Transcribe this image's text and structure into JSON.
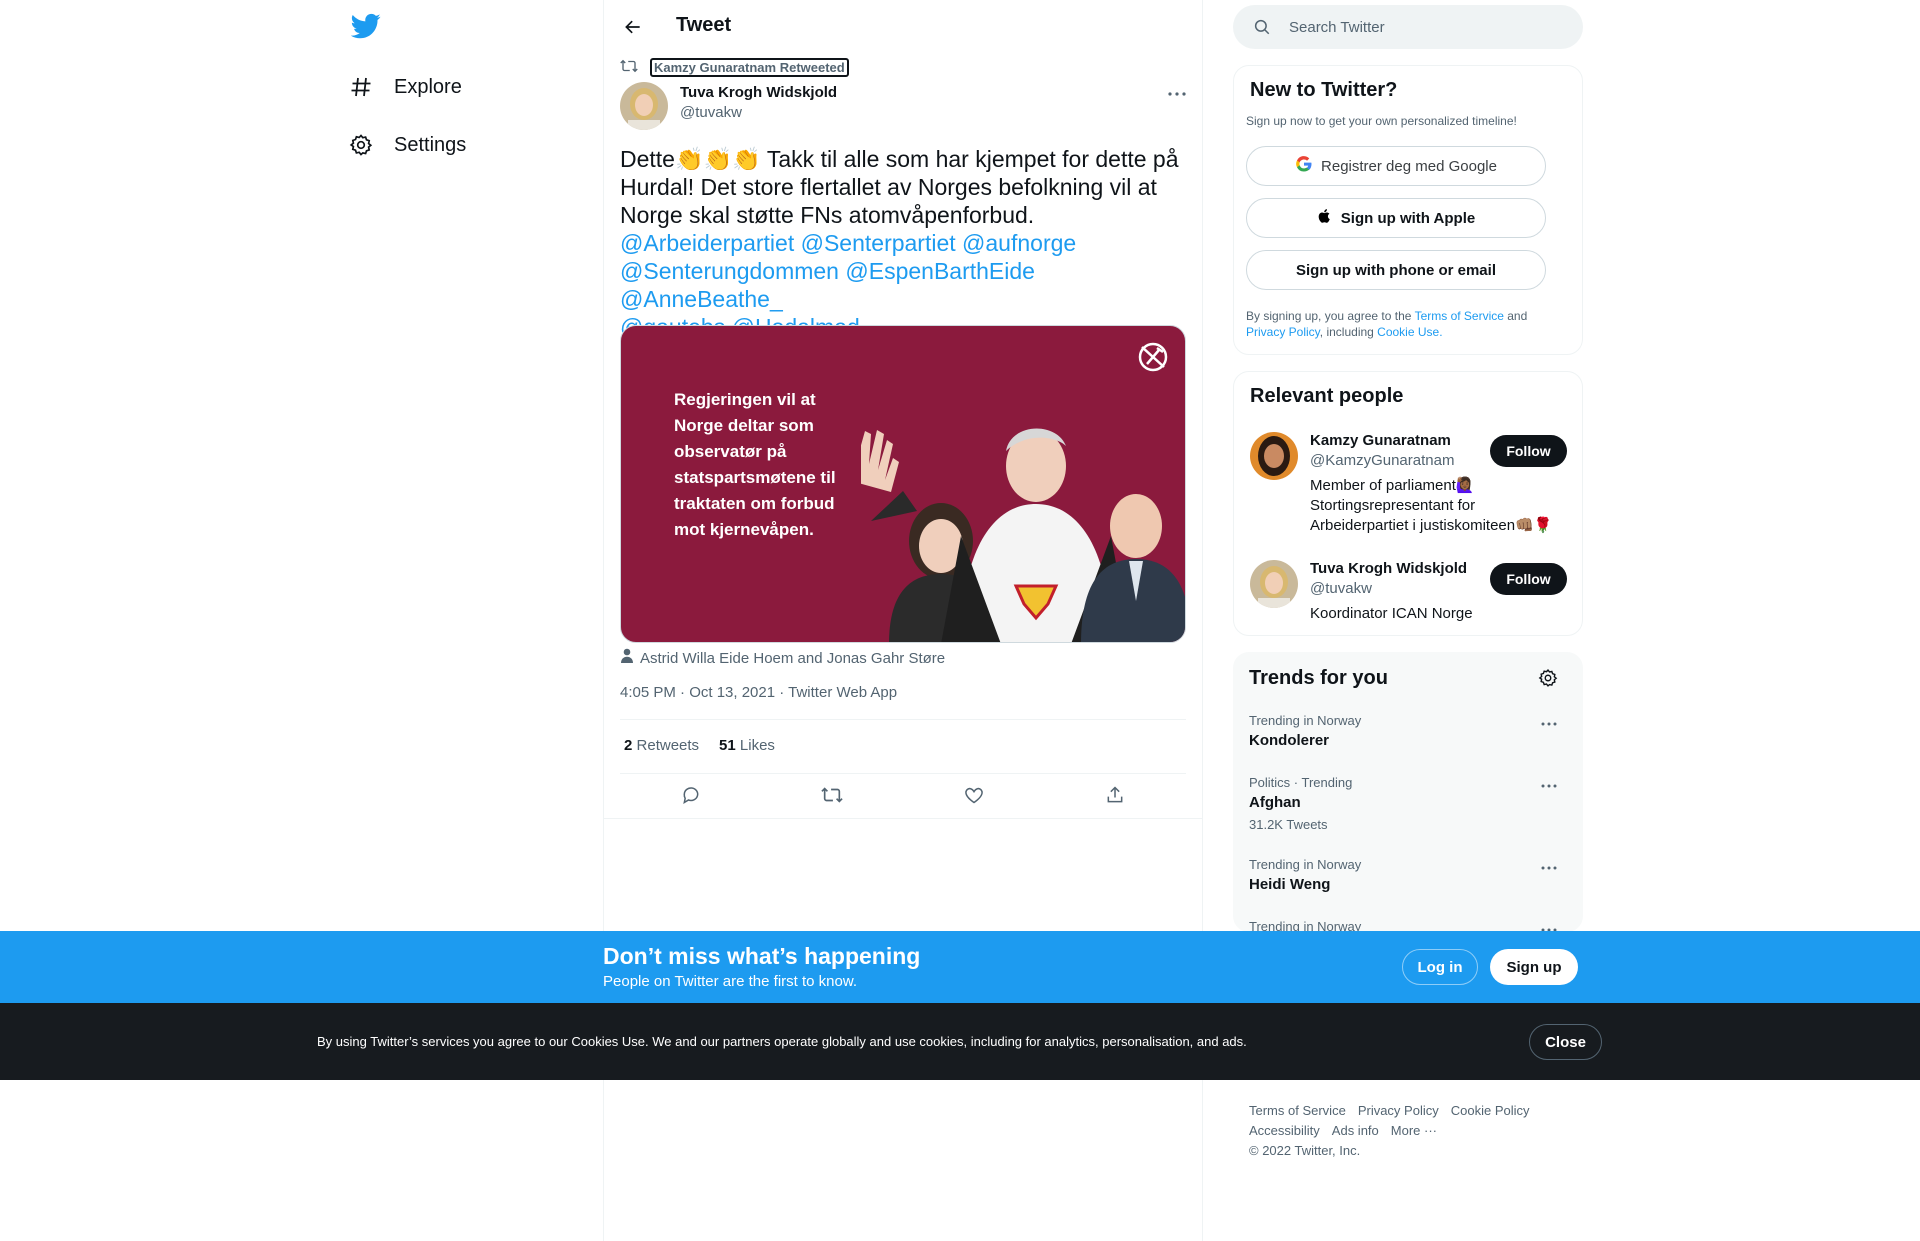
{
  "nav": {
    "logo": "twitter-bird-icon",
    "items": [
      {
        "label": "Explore",
        "icon": "hashtag-icon"
      },
      {
        "label": "Settings",
        "icon": "gear-icon"
      }
    ]
  },
  "header": {
    "title": "Tweet"
  },
  "tweet": {
    "retweeted_by": "Kamzy Gunaratnam Retweeted",
    "author_name": "Tuva Krogh Widskjold",
    "author_handle": "@tuvakw",
    "text_prefix": "Dette",
    "text_body": " Takk til alle som har kjempet for dette på Hurdal! Det store flertallet av Norges befolkning vil at Norge skal støtte FNs atomvåpenforbud.",
    "mentions": [
      "@Arbeiderpartiet",
      "@Senterpartiet",
      "@aufnorge",
      "@Senterungdommen",
      "@EspenBarthEide",
      "@AnneBeathe_",
      "@gautebs",
      "@Hodalmad"
    ],
    "media_text": "Regjeringen vil at Norge deltar som observatør på statspartsmøtene til traktaten om forbud mot kjernevåpen.",
    "tagged": "Astrid Willa Eide Hoem and Jonas Gahr Støre",
    "timestamp": "4:05 PM · Oct 13, 2021 · Twitter Web App",
    "retweets_count": "2",
    "retweets_label": "Retweets",
    "likes_count": "51",
    "likes_label": "Likes"
  },
  "search": {
    "placeholder": "Search Twitter"
  },
  "signup_card": {
    "title": "New to Twitter?",
    "subtitle": "Sign up now to get your own personalized timeline!",
    "google": "Registrer deg med Google",
    "apple": "Sign up with Apple",
    "phone": "Sign up with phone or email",
    "legal_1": "By signing up, you agree to the ",
    "terms": "Terms of Service",
    "legal_2": " and ",
    "privacy": "Privacy Policy",
    "legal_3": ", including ",
    "cookie": "Cookie Use."
  },
  "relevant": {
    "title": "Relevant people",
    "people": [
      {
        "name": "Kamzy Gunaratnam",
        "handle": "@KamzyGunaratnam",
        "bio": "Member of parliament🙋🏾‍♀️ Stortingsrepresentant for Arbeiderpartiet i justiskomiteen👊🏽🌹",
        "follow": "Follow"
      },
      {
        "name": "Tuva Krogh Widskjold",
        "handle": "@tuvakw",
        "bio": "Koordinator ICAN Norge",
        "follow": "Follow"
      }
    ]
  },
  "trends": {
    "title": "Trends for you",
    "items": [
      {
        "meta": "Trending in Norway",
        "name": "Kondolerer",
        "count": ""
      },
      {
        "meta": "Politics · Trending",
        "name": "Afghan",
        "count": "31.2K Tweets"
      },
      {
        "meta": "Trending in Norway",
        "name": "Heidi Weng",
        "count": ""
      },
      {
        "meta": "Trending in Norway",
        "name": "",
        "count": ""
      }
    ]
  },
  "footer": {
    "links": [
      "Terms of Service",
      "Privacy Policy",
      "Cookie Policy",
      "Accessibility",
      "Ads info",
      "More ···"
    ],
    "copyright": "© 2022 Twitter, Inc."
  },
  "banner": {
    "title": "Don’t miss what’s happening",
    "subtitle": "People on Twitter are the first to know.",
    "login": "Log in",
    "signup": "Sign up"
  },
  "cookie_bar": {
    "text": "By using Twitter’s services you agree to our Cookies Use. We and our partners operate globally and use cookies, including for analytics, personalisation, and ads.",
    "close": "Close"
  },
  "colors": {
    "accent": "#1d9bf0",
    "text": "#0f1419",
    "muted": "#536471",
    "media_bg": "#8b1a3d"
  }
}
